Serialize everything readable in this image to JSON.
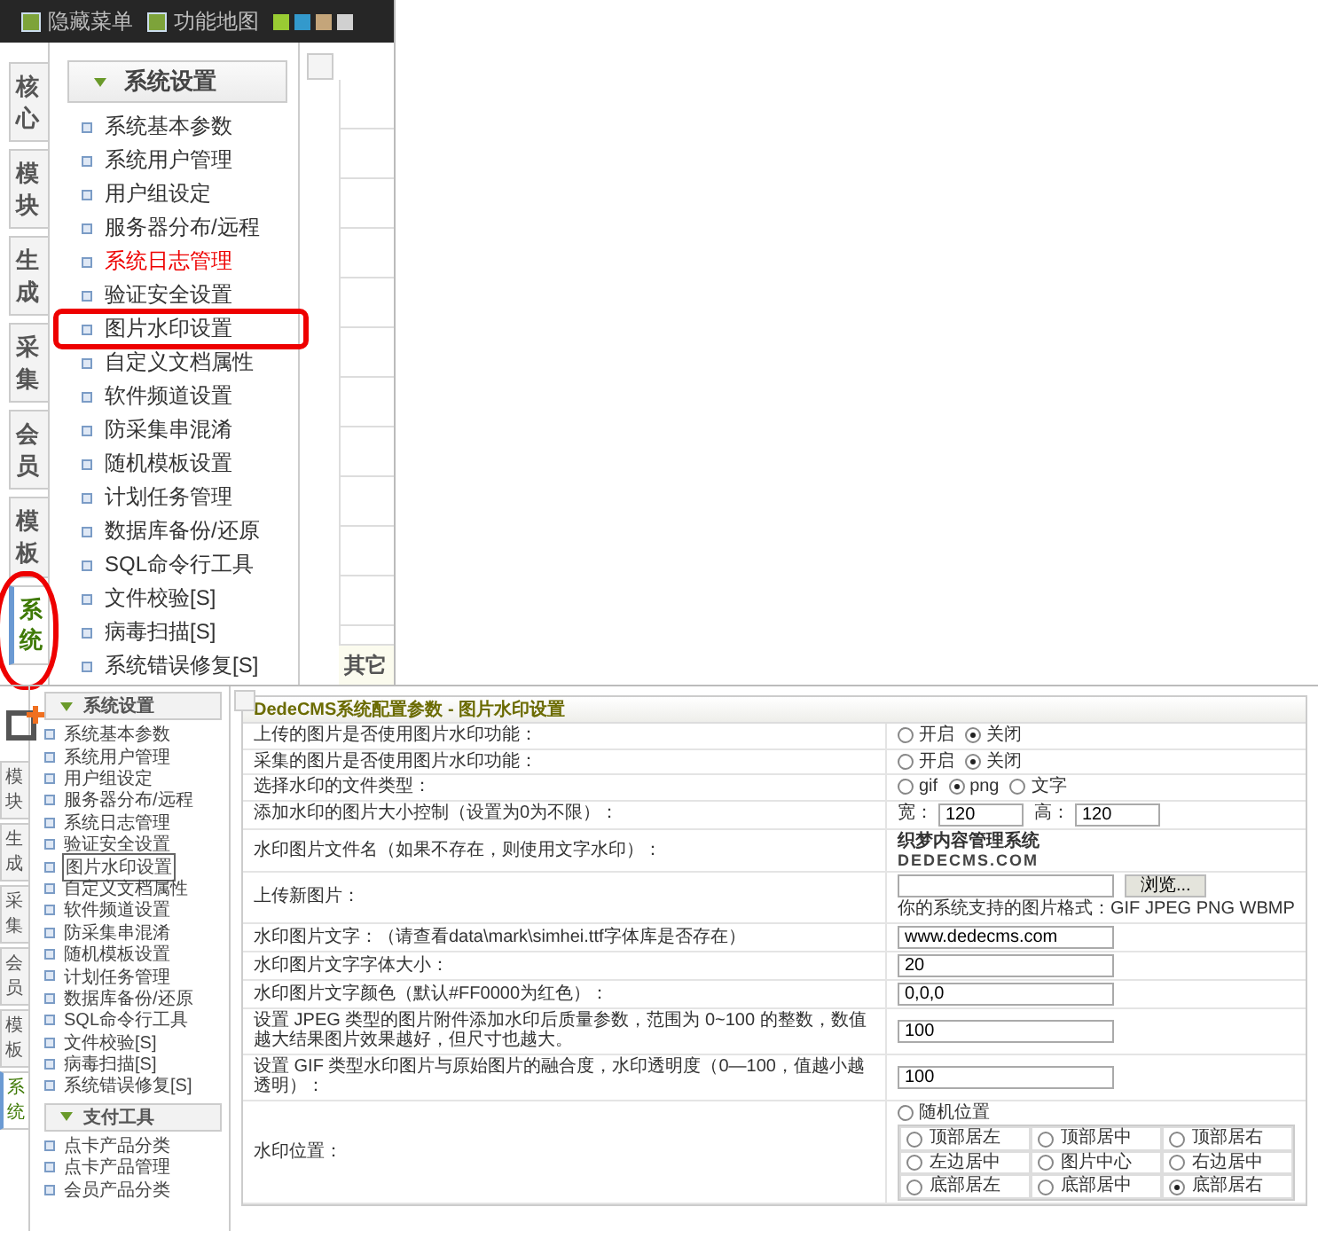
{
  "top": {
    "toolbar": [
      {
        "label": "隐藏菜单"
      },
      {
        "label": "功能地图"
      }
    ],
    "swatches": [
      {
        "color": "#99cc33"
      },
      {
        "color": "#3399cc"
      },
      {
        "color": "#c4a57a"
      },
      {
        "color": "#d0d0d0"
      }
    ],
    "tabs": [
      {
        "label": "核心",
        "selected": false,
        "circled": false
      },
      {
        "label": "模块",
        "selected": false,
        "circled": false
      },
      {
        "label": "生成",
        "selected": false,
        "circled": false
      },
      {
        "label": "采集",
        "selected": false,
        "circled": false
      },
      {
        "label": "会员",
        "selected": false,
        "circled": false
      },
      {
        "label": "模板",
        "selected": false,
        "circled": false
      },
      {
        "label": "系统",
        "selected": true,
        "circled": true
      }
    ],
    "menu_title": "系统设置",
    "menu": [
      {
        "label": "系统基本参数",
        "emphasized": false,
        "circled": false
      },
      {
        "label": "系统用户管理",
        "emphasized": false,
        "circled": false
      },
      {
        "label": "用户组设定",
        "emphasized": false,
        "circled": false
      },
      {
        "label": "服务器分布/远程",
        "emphasized": false,
        "circled": false
      },
      {
        "label": "系统日志管理",
        "emphasized": true,
        "circled": false
      },
      {
        "label": "验证安全设置",
        "emphasized": false,
        "circled": false
      },
      {
        "label": "图片水印设置",
        "emphasized": false,
        "circled": true
      },
      {
        "label": "自定义文档属性",
        "emphasized": false,
        "circled": false
      },
      {
        "label": "软件频道设置",
        "emphasized": false,
        "circled": false
      },
      {
        "label": "防采集串混淆",
        "emphasized": false,
        "circled": false
      },
      {
        "label": "随机模板设置",
        "emphasized": false,
        "circled": false
      },
      {
        "label": "计划任务管理",
        "emphasized": false,
        "circled": false
      },
      {
        "label": "数据库备份/还原",
        "emphasized": false,
        "circled": false
      },
      {
        "label": "SQL命令行工具",
        "emphasized": false,
        "circled": false
      },
      {
        "label": "文件校验[S]",
        "emphasized": false,
        "circled": false
      },
      {
        "label": "病毒扫描[S]",
        "emphasized": false,
        "circled": false
      },
      {
        "label": "系统错误修复[S]",
        "emphasized": false,
        "circled": false
      }
    ],
    "strip_text": "其它"
  },
  "bottom": {
    "tabs": [
      {
        "label": "模块",
        "selected": false
      },
      {
        "label": "生成",
        "selected": false
      },
      {
        "label": "采集",
        "selected": false
      },
      {
        "label": "会员",
        "selected": false
      },
      {
        "label": "模板",
        "selected": false
      },
      {
        "label": "系统",
        "selected": true
      }
    ],
    "menu_groups": [
      {
        "title": "系统设置",
        "items": [
          {
            "label": "系统基本参数",
            "selected": false
          },
          {
            "label": "系统用户管理",
            "selected": false
          },
          {
            "label": "用户组设定",
            "selected": false
          },
          {
            "label": "服务器分布/远程",
            "selected": false
          },
          {
            "label": "系统日志管理",
            "selected": false
          },
          {
            "label": "验证安全设置",
            "selected": false
          },
          {
            "label": "图片水印设置",
            "selected": true
          },
          {
            "label": "自定义文档属性",
            "selected": false
          },
          {
            "label": "软件频道设置",
            "selected": false
          },
          {
            "label": "防采集串混淆",
            "selected": false
          },
          {
            "label": "随机模板设置",
            "selected": false
          },
          {
            "label": "计划任务管理",
            "selected": false
          },
          {
            "label": "数据库备份/还原",
            "selected": false
          },
          {
            "label": "SQL命令行工具",
            "selected": false
          },
          {
            "label": "文件校验[S]",
            "selected": false
          },
          {
            "label": "病毒扫描[S]",
            "selected": false
          },
          {
            "label": "系统错误修复[S]",
            "selected": false
          }
        ]
      },
      {
        "title": "支付工具",
        "items": [
          {
            "label": "点卡产品分类",
            "selected": false
          },
          {
            "label": "点卡产品管理",
            "selected": false
          },
          {
            "label": "会员产品分类",
            "selected": false
          }
        ]
      }
    ],
    "form_title": "DedeCMS系统配置参数 - 图片水印设置",
    "rows": [
      {
        "kind": "radio",
        "label": "上传的图片是否使用图片水印功能：",
        "options": [
          {
            "label": "开启",
            "selected": false
          },
          {
            "label": "关闭",
            "selected": true
          }
        ]
      },
      {
        "kind": "radio",
        "label": "采集的图片是否使用图片水印功能：",
        "options": [
          {
            "label": "开启",
            "selected": false
          },
          {
            "label": "关闭",
            "selected": true
          }
        ]
      },
      {
        "kind": "radio",
        "label": "选择水印的文件类型：",
        "options": [
          {
            "label": "gif",
            "selected": false
          },
          {
            "label": "png",
            "selected": true
          },
          {
            "label": "文字",
            "selected": false
          }
        ]
      },
      {
        "kind": "size",
        "label": "添加水印的图片大小控制（设置为0为不限）：",
        "fields": [
          {
            "label": "宽：",
            "value": "120"
          },
          {
            "label": "高：",
            "value": "120"
          }
        ]
      },
      {
        "kind": "image",
        "label": "水印图片文件名（如果不存在，则使用文字水印）：",
        "lines": [
          "织梦内容管理系统",
          "DEDECMS.COM"
        ]
      },
      {
        "kind": "upload",
        "label": "上传新图片：",
        "button": "浏览...",
        "note": "你的系统支持的图片格式：GIF JPEG PNG WBMP"
      },
      {
        "kind": "text",
        "label": "水印图片文字：（请查看data\\mark\\simhei.ttf字体库是否存在）",
        "value": "www.dedecms.com"
      },
      {
        "kind": "text",
        "label": "水印图片文字字体大小：",
        "value": "20"
      },
      {
        "kind": "text",
        "label": "水印图片文字颜色（默认#FF0000为红色）：",
        "value": "0,0,0"
      },
      {
        "kind": "text",
        "label": "设置 JPEG 类型的图片附件添加水印后质量参数，范围为 0~100 的整数，数值越大结果图片效果越好，但尺寸也越大。",
        "value": "100"
      },
      {
        "kind": "text",
        "label": "设置 GIF 类型水印图片与原始图片的融合度，水印透明度（0—100，值越小越透明）：",
        "value": "100"
      },
      {
        "kind": "position",
        "label": "水印位置：",
        "random": {
          "label": "随机位置",
          "selected": false
        },
        "grid": [
          {
            "label": "顶部居左",
            "selected": false
          },
          {
            "label": "顶部居中",
            "selected": false
          },
          {
            "label": "顶部居右",
            "selected": false
          },
          {
            "label": "左边居中",
            "selected": false
          },
          {
            "label": "图片中心",
            "selected": false
          },
          {
            "label": "右边居中",
            "selected": false
          },
          {
            "label": "底部居左",
            "selected": false
          },
          {
            "label": "底部居中",
            "selected": false
          },
          {
            "label": "底部居右",
            "selected": true
          }
        ]
      }
    ]
  }
}
